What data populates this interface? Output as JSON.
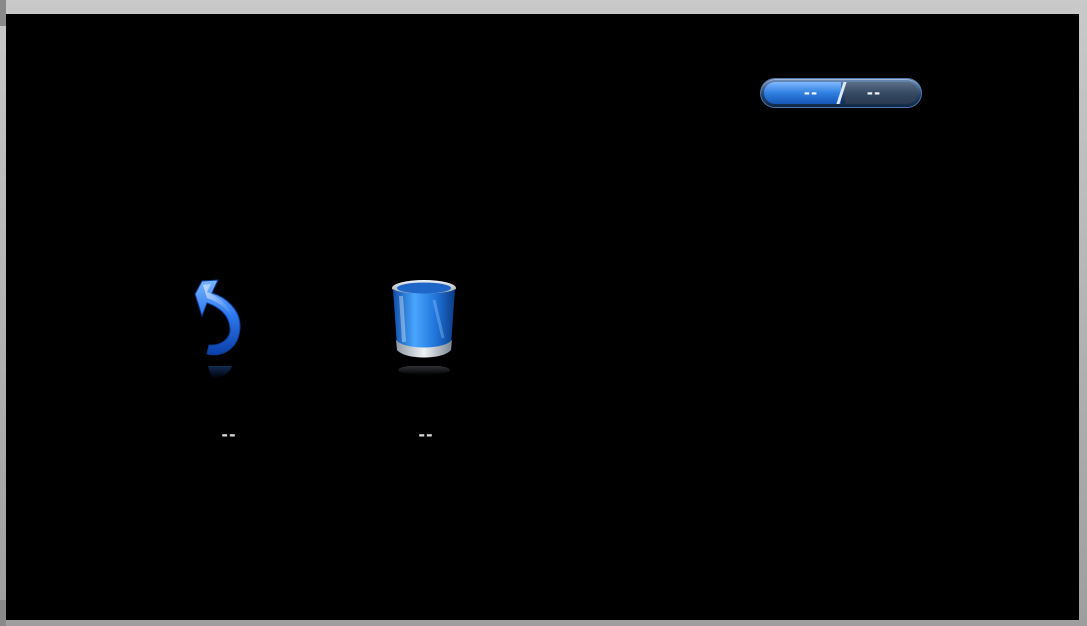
{
  "pagination": {
    "current": "--",
    "total": "--"
  },
  "tiles": [
    {
      "label": "--",
      "icon": "back-arrow-icon",
      "accent": "#2b6cff"
    },
    {
      "label": "--",
      "icon": "trash-bin-icon",
      "accent": "#36a0ff"
    }
  ],
  "colors": {
    "background": "#000000",
    "frame": "#b9b9b9",
    "accent_blue": "#2f7fe0",
    "label_gray": "#d7d7d7"
  }
}
